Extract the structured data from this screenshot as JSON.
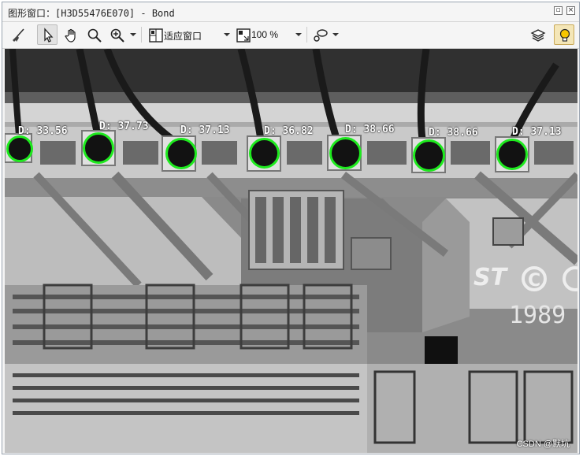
{
  "window": {
    "title": "图形窗口：[H3D55476E070] - Bond",
    "restore_icon": "restore-icon",
    "close_icon": "close-icon"
  },
  "toolbar": {
    "fit_option": "适应窗口",
    "zoom_value": "100 %",
    "icons": [
      "broom-icon",
      "pointer-icon",
      "hand-icon",
      "magnifier-icon",
      "zoom-in-icon",
      "fit-window-icon",
      "zoom-percent-icon",
      "lasso-icon",
      "layers-icon",
      "lightbulb-icon"
    ]
  },
  "measurements": [
    {
      "label": "D: 33.56"
    },
    {
      "label": "D: 37.73"
    },
    {
      "label": "D: 37.13"
    },
    {
      "label": "D: 36.82"
    },
    {
      "label": "D: 38.66"
    },
    {
      "label": "D: 38.66"
    },
    {
      "label": "D: 37.13"
    }
  ],
  "die_marking": {
    "logo": "ST",
    "copyright_marks": [
      "C",
      "C"
    ],
    "year": "1989"
  },
  "watermark": "CSDN @默坑",
  "colors": {
    "measure_circle": "#1eea1e",
    "label_text": "#ffffff",
    "highlight_button": "#f4e6b7"
  }
}
